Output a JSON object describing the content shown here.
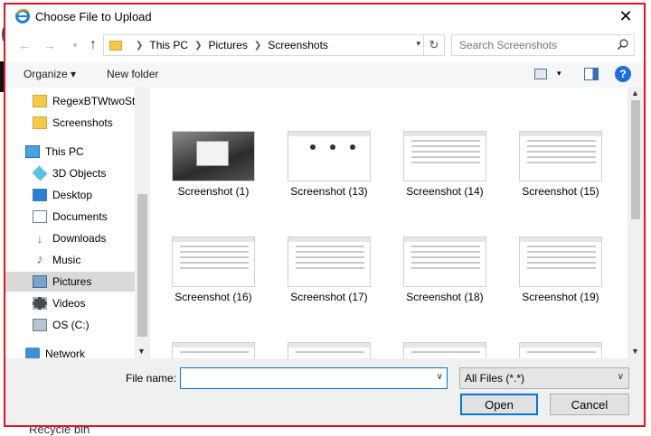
{
  "dialog": {
    "title": "Choose File to Upload",
    "close_label": "✕"
  },
  "address": {
    "crumbs": [
      "This PC",
      "Pictures",
      "Screenshots"
    ]
  },
  "search": {
    "placeholder": "Search Screenshots"
  },
  "commands": {
    "organize": "Organize ▾",
    "new_folder": "New folder",
    "help": "?"
  },
  "navpane": {
    "items": [
      {
        "label": "RegexBTWtwoSt",
        "icon": "folder-icon"
      },
      {
        "label": "Screenshots",
        "icon": "folder-icon"
      },
      {
        "label": "This PC",
        "icon": "computer-icon"
      },
      {
        "label": "3D Objects",
        "icon": "3d-objects-icon"
      },
      {
        "label": "Desktop",
        "icon": "desktop-icon"
      },
      {
        "label": "Documents",
        "icon": "documents-icon"
      },
      {
        "label": "Downloads",
        "icon": "downloads-icon"
      },
      {
        "label": "Music",
        "icon": "music-icon"
      },
      {
        "label": "Pictures",
        "icon": "pictures-icon",
        "selected": true
      },
      {
        "label": "Videos",
        "icon": "videos-icon"
      },
      {
        "label": "OS (C:)",
        "icon": "drive-icon"
      },
      {
        "label": "Network",
        "icon": "network-icon"
      }
    ]
  },
  "files": [
    {
      "label": "Screenshot (1)"
    },
    {
      "label": "Screenshot (13)"
    },
    {
      "label": "Screenshot (14)"
    },
    {
      "label": "Screenshot (15)"
    },
    {
      "label": "Screenshot (16)"
    },
    {
      "label": "Screenshot (17)"
    },
    {
      "label": "Screenshot (18)"
    },
    {
      "label": "Screenshot (19)"
    }
  ],
  "bottom": {
    "file_name_label": "File name:",
    "file_name_value": "",
    "filter_value": "All Files (*.*)",
    "open_label": "Open",
    "cancel_label": "Cancel"
  },
  "background": {
    "recycle_label": "Recycle bin"
  },
  "colors": {
    "accent": "#0078d7",
    "frame": "#e81123",
    "selected": "#d9d9d9"
  }
}
